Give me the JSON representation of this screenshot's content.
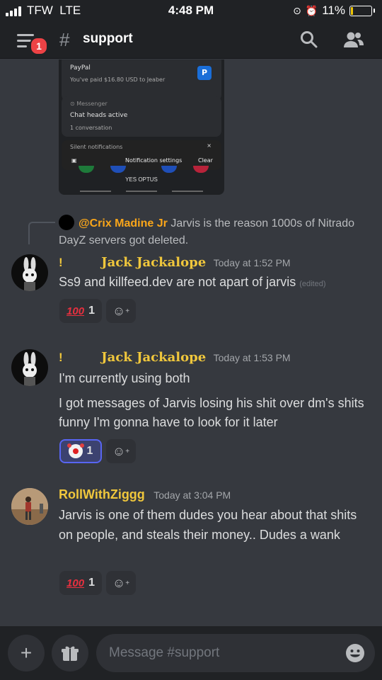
{
  "status": {
    "carrier": "TFW",
    "network": "LTE",
    "time": "4:48 PM",
    "battery": "11%",
    "battery_level": 0.11
  },
  "header": {
    "badge": "1",
    "channel": "support",
    "hash_icon": "#"
  },
  "embedded_screenshot": {
    "paypal_title": "PayPal",
    "paypal_text": "You've paid $16.80 USD to Jeaber",
    "messenger_label": "Messenger",
    "chatheads_title": "Chat heads active",
    "chatheads_sub": "1 conversation",
    "silent": "Silent notifications",
    "notif_settings": "Notification settings",
    "clear": "Clear",
    "carrier": "YES OPTUS"
  },
  "reply": {
    "mention": "@Crix Madine Jr",
    "text": "Jarvis is the reason 1000s of Nitrado DayZ servers got deleted."
  },
  "messages": [
    {
      "bang": "!",
      "username": "Jack Jackalope",
      "timestamp": "Today at 1:52 PM",
      "lines": [
        "Ss9 and killfeed.dev are not apart of jarvis"
      ],
      "edited": "(edited)",
      "reaction_emoji": "100",
      "reaction_count": "1"
    },
    {
      "bang": "!",
      "username": "Jack Jackalope",
      "timestamp": "Today at 1:53 PM",
      "lines": [
        "I'm currently using both",
        "I got messages of Jarvis losing his shit over dm's shits funny I'm gonna have to look for it later"
      ],
      "reaction_emoji": "clown",
      "reaction_count": "1"
    },
    {
      "username": "RollWithZiggg",
      "timestamp": "Today at 3:04 PM",
      "lines": [
        "Jarvis is one of them dudes you hear about that shits on people, and steals their money.. Dudes a wank"
      ],
      "reaction_emoji": "100",
      "reaction_count": "1"
    }
  ],
  "composer": {
    "placeholder": "Message #support"
  },
  "colors": {
    "accent": "#5865f2",
    "mention": "#faa61a",
    "username_gold": "#f0c73c",
    "badge": "#ed4245"
  }
}
